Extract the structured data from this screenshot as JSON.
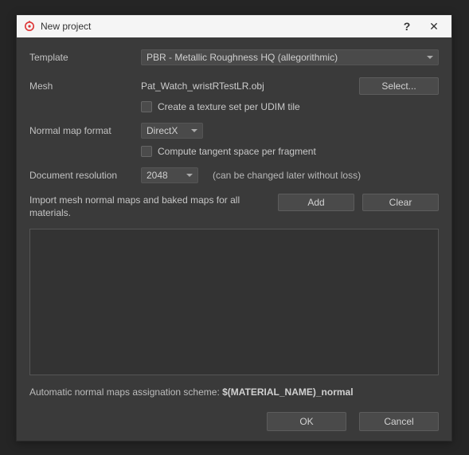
{
  "window": {
    "title": "New project",
    "help_symbol": "?",
    "close_symbol": "✕"
  },
  "labels": {
    "template": "Template",
    "mesh": "Mesh",
    "normal_map_format": "Normal map format",
    "document_resolution": "Document resolution"
  },
  "template": {
    "selected": "PBR - Metallic Roughness HQ (allegorithmic)"
  },
  "mesh": {
    "filename": "Pat_Watch_wristRTestLR.obj",
    "select_button": "Select...",
    "udim_checkbox_label": "Create a texture set per UDIM tile"
  },
  "normal_map": {
    "selected": "DirectX",
    "tangent_checkbox_label": "Compute tangent space per fragment"
  },
  "resolution": {
    "selected": "2048",
    "hint": "(can be changed later without loss)"
  },
  "import": {
    "label": "Import mesh normal maps and baked maps for all materials.",
    "add_button": "Add",
    "clear_button": "Clear"
  },
  "footer": {
    "scheme_prefix": "Automatic normal maps assignation scheme: ",
    "scheme_value": "$(MATERIAL_NAME)_normal",
    "ok": "OK",
    "cancel": "Cancel"
  }
}
